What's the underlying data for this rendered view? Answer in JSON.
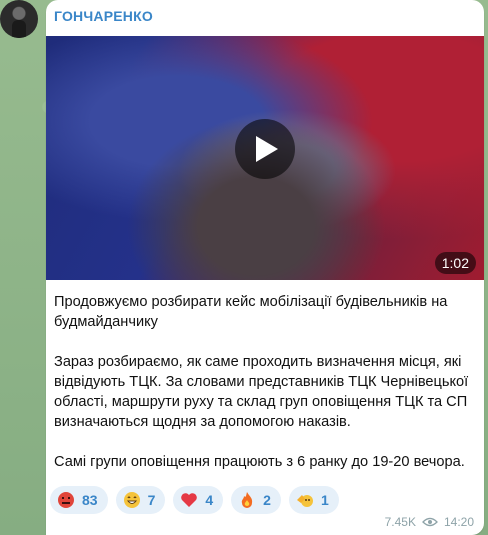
{
  "sender": {
    "name": "ГОНЧАРЕНКО"
  },
  "video": {
    "duration": "1:02"
  },
  "message": {
    "p1": "Продовжуємо розбирати кейс мобілізації будівельників на будмайданчику",
    "p2": "Зараз розбираємо, як саме проходить визначення місця, які відвідують ТЦК. За словами представників ТЦК Чернівецької області, маршрути руху та склад груп оповіщення ТЦК та СП визначаються щодня за допомогою наказів.",
    "p3": "Самі групи оповіщення працюють з 6 ранку до 19-20 вечора."
  },
  "reactions": [
    {
      "icon": "angry-face-icon",
      "count": "83"
    },
    {
      "icon": "grin-face-icon",
      "count": "7"
    },
    {
      "icon": "heart-icon",
      "count": "4"
    },
    {
      "icon": "fire-icon",
      "count": "2"
    },
    {
      "icon": "clapping-face-icon",
      "count": "1"
    }
  ],
  "meta": {
    "views": "7.45K",
    "time": "14:20"
  },
  "colors": {
    "accent": "#3a86c8",
    "bubble": "#ffffff",
    "reaction_bg": "#e6f0f9"
  }
}
